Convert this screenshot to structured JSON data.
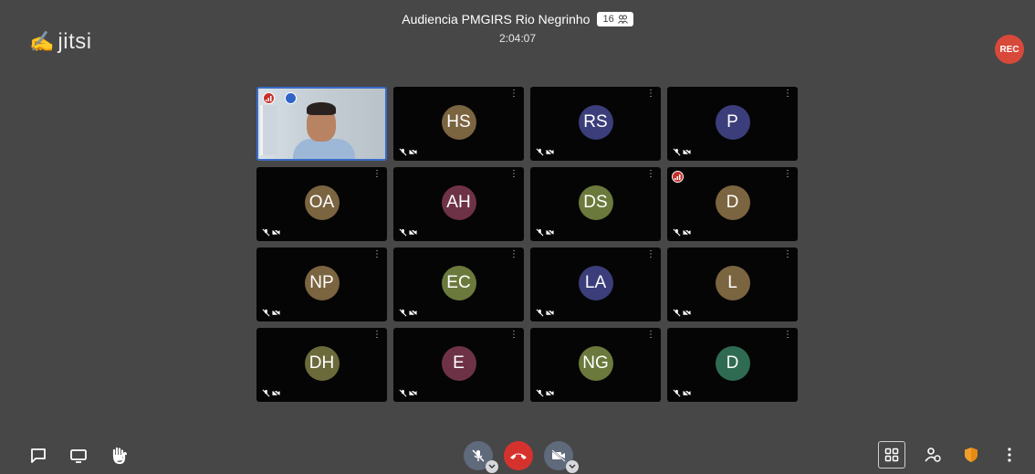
{
  "app": {
    "logo_text": "jitsi"
  },
  "header": {
    "meeting_title": "Audiencia PMGIRS Rio Negrinho",
    "participant_count": "16",
    "timer": "2:04:07"
  },
  "recording": {
    "badge_label": "REC"
  },
  "tiles": [
    {
      "initials": "",
      "self": true,
      "color": "#000000",
      "badge": "connection"
    },
    {
      "initials": "HS",
      "color": "#7b6440"
    },
    {
      "initials": "RS",
      "color": "#3b3e7a"
    },
    {
      "initials": "P",
      "color": "#3b3e7a"
    },
    {
      "initials": "OA",
      "color": "#7b6440"
    },
    {
      "initials": "AH",
      "color": "#6e3247"
    },
    {
      "initials": "DS",
      "color": "#6b7a3c"
    },
    {
      "initials": "D",
      "color": "#7b6440",
      "badge": "connection"
    },
    {
      "initials": "NP",
      "color": "#7b6440"
    },
    {
      "initials": "EC",
      "color": "#6b7a3c"
    },
    {
      "initials": "LA",
      "color": "#3b3e7a"
    },
    {
      "initials": "L",
      "color": "#7b6440"
    },
    {
      "initials": "DH",
      "color": "#6b6a3a"
    },
    {
      "initials": "E",
      "color": "#6e3247"
    },
    {
      "initials": "NG",
      "color": "#6b7a3c"
    },
    {
      "initials": "D",
      "color": "#2f6b52"
    }
  ],
  "toolbar": {
    "left": [
      "chat-icon",
      "screen-share-icon",
      "raise-hand-icon"
    ],
    "center": [
      "mute-mic-icon",
      "hangup-icon",
      "camera-off-icon"
    ],
    "right": [
      "tile-view-icon",
      "invite-people-icon",
      "security-shield-icon",
      "more-options-icon"
    ]
  }
}
